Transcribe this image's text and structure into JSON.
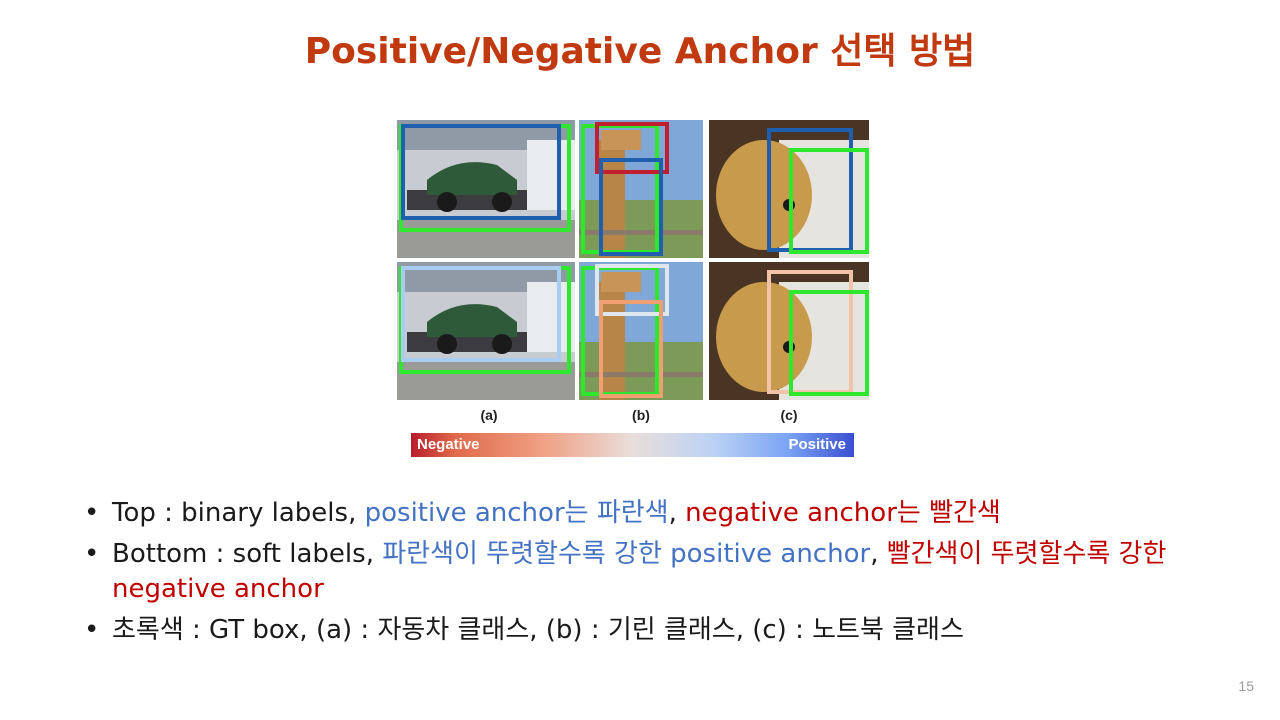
{
  "slide": {
    "title": "Positive/Negative Anchor 선택 방법",
    "page_number": "15"
  },
  "figure": {
    "panel_labels": [
      "(a)",
      "(b)",
      "(c)"
    ],
    "colorbar": {
      "negative_label": "Negative",
      "positive_label": "Positive"
    },
    "colors": {
      "gt_box": "#2ee82e",
      "positive_box": "#1f5fb0",
      "negative_box": "#c21f2f",
      "soft_light_blue": "#a9cdf0",
      "soft_peach": "#f2c3a8",
      "soft_orange": "#f0a070"
    }
  },
  "bullets": {
    "b1": {
      "prefix": "Top : binary labels, ",
      "blue": "positive anchor는 파란색",
      "sep": ", ",
      "red": "negative anchor는 빨간색"
    },
    "b2": {
      "prefix": "Bottom : soft labels, ",
      "blue": "파란색이 뚜렷할수록 강한 positive anchor",
      "sep": ", ",
      "red": "빨간색이 뚜렷할수록 강한 negative anchor"
    },
    "b3": {
      "text": "초록색 : GT box, (a) : 자동차 클래스, (b) : 기린 클래스, (c) : 노트북 클래스"
    }
  }
}
